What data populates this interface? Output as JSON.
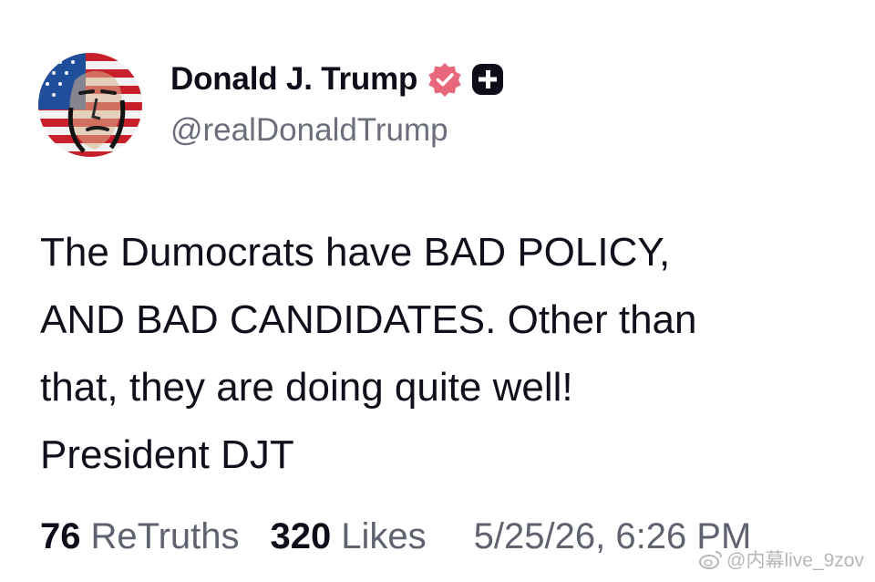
{
  "author": {
    "display_name": "Donald J. Trump",
    "handle": "@realDonaldTrump",
    "avatar_icon": "flag-portrait-avatar",
    "verified_badge_icon": "verified-badge-icon",
    "verified_color": "#e8677a",
    "follow_icon": "plus-icon"
  },
  "post": {
    "lines": [
      "The Dumocrats have BAD POLICY,",
      "AND BAD CANDIDATES. Other than",
      "that, they are doing quite well!",
      "President DJT"
    ]
  },
  "stats": {
    "retruths_count": "76",
    "retruths_label": "ReTruths",
    "likes_count": "320",
    "likes_label": "Likes",
    "timestamp": "5/25/26, 6:26 PM"
  },
  "watermark": {
    "icon": "weibo-icon",
    "text": "@内幕live_9zov"
  }
}
